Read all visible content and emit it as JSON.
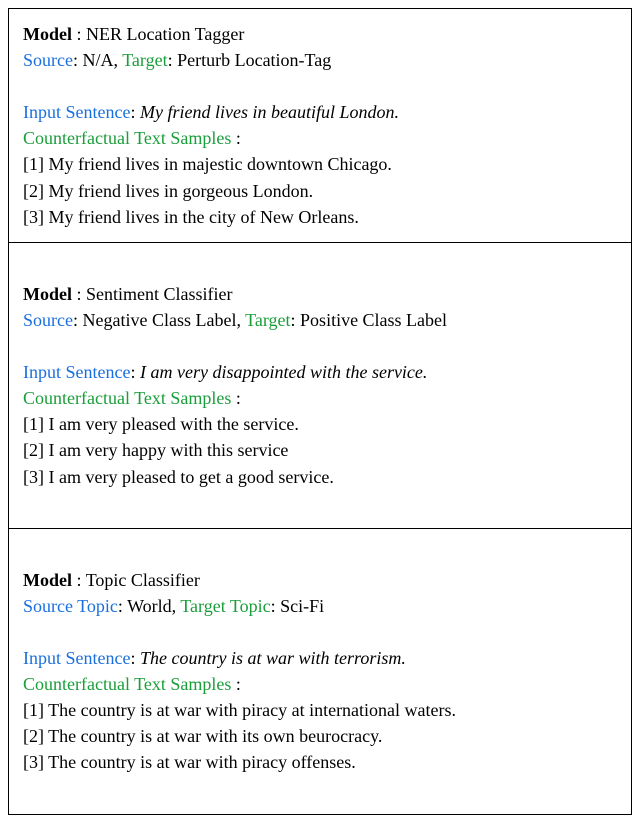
{
  "panels": [
    {
      "model_label": "Model",
      "model_name": "NER Location Tagger",
      "source_label": "Source",
      "source_value": "N/A",
      "target_label": "Target",
      "target_value": "Perturb Location-Tag",
      "input_label": "Input Sentence",
      "input_value": "My friend lives in beautiful London.",
      "cf_label": "Counterfactual Text Samples",
      "samples": [
        "[1] My friend lives in majestic downtown Chicago.",
        "[2] My friend lives in gorgeous London.",
        "[3] My friend lives in the city of New Orleans."
      ]
    },
    {
      "model_label": "Model",
      "model_name": "Sentiment Classifier",
      "source_label": "Source",
      "source_value": "Negative Class Label",
      "target_label": "Target",
      "target_value": "Positive Class Label",
      "input_label": "Input Sentence",
      "input_value": "I am very disappointed with the service.",
      "cf_label": "Counterfactual Text Samples",
      "samples": [
        "[1] I am very pleased with the service.",
        "[2] I am very happy with this service",
        "[3] I am very pleased to get a good service."
      ]
    },
    {
      "model_label": "Model",
      "model_name": "Topic Classifier",
      "source_label": "Source Topic",
      "source_value": "World",
      "target_label": "Target Topic",
      "target_value": "Sci-Fi",
      "input_label": "Input Sentence",
      "input_value": "The country is at war with terrorism.",
      "cf_label": "Counterfactual Text Samples",
      "samples": [
        "[1] The country is at war with piracy at international waters.",
        "[2] The country is at war with its own beurocracy.",
        "[3] The country is at war with piracy offenses."
      ]
    }
  ]
}
